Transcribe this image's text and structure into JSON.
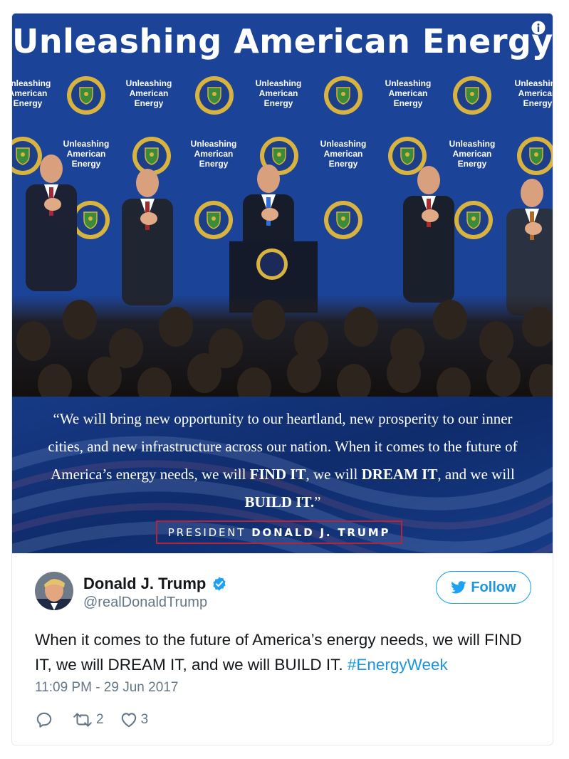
{
  "media": {
    "headline": "Unleashing American Energy",
    "backdrop_text": [
      "Unleashing",
      "American",
      "Energy"
    ],
    "quote": {
      "p1": "“We will bring new opportunity to our heartland, new prosperity to our inner cities, and new infrastructure across our nation.  When it comes to the future of America’s energy needs, we will ",
      "b1": "FIND IT",
      "p2": ", we will ",
      "b2": "DREAM IT",
      "p3": ", and we will ",
      "b3": "BUILD IT.",
      "p4": "”"
    },
    "attribution": {
      "title": "PRESIDENT",
      "name": "DONALD J. TRUMP"
    },
    "colors": {
      "backdrop": "#1a3e92",
      "seal_gold": "#d8b340",
      "frame_red": "#b2253a"
    }
  },
  "tweet": {
    "display_name": "Donald J. Trump",
    "handle": "@realDonaldTrump",
    "follow_label": "Follow",
    "text": "When it comes to the future of America’s energy needs, we will FIND IT, we will DREAM IT, and we will BUILD IT. ",
    "hashtag": "#EnergyWeek",
    "timestamp": "11:09 PM - 29 Jun 2017",
    "actions": {
      "reply_icon": "reply-icon",
      "retweet_icon": "retweet-icon",
      "retweet_count": "2",
      "like_icon": "heart-icon",
      "like_count": "3"
    },
    "colors": {
      "link": "#1b95e0",
      "secondary": "#657786"
    }
  }
}
